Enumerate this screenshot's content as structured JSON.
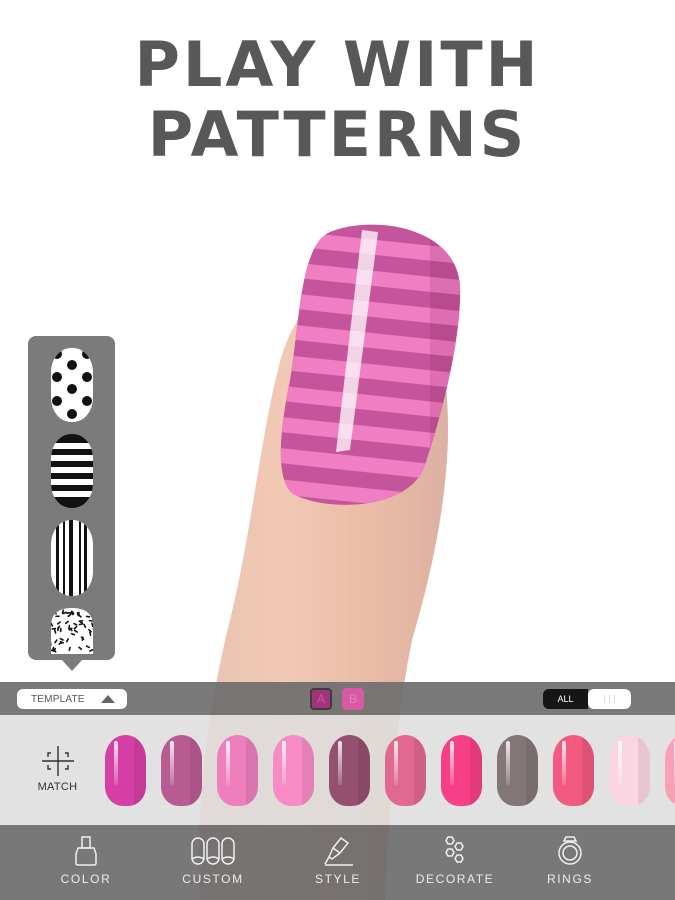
{
  "headline": {
    "line1": "PLAY WITH",
    "line2": "PATTERNS"
  },
  "preview": {
    "nail_pattern": "horizontal-stripes",
    "stripe_color_a": "#c4559c",
    "stripe_color_b": "#ef7ec2"
  },
  "pattern_picker": {
    "items": [
      {
        "name": "polka-dots",
        "icon": "polka-dot-nail-icon"
      },
      {
        "name": "horizontal-stripes",
        "icon": "horizontal-stripe-nail-icon"
      },
      {
        "name": "vertical-stripes",
        "icon": "vertical-stripe-nail-icon"
      },
      {
        "name": "sprinkles",
        "icon": "sprinkle-nail-icon"
      }
    ]
  },
  "toolbar": {
    "template_label": "TEMPLATE",
    "color_a_label": "A",
    "color_b_label": "B",
    "color_a": "#a1347a",
    "color_b": "#d85aa5",
    "toggle_all_label": "ALL",
    "toggle_single_icon": "three-bars-icon"
  },
  "color_strip": {
    "match_label": "MATCH",
    "swatches": [
      "#d63fa6",
      "#b85b92",
      "#ee7fbf",
      "#f78bc5",
      "#93506f",
      "#e06891",
      "#f63f86",
      "#837677",
      "#f25a82",
      "#fad6e2",
      "#f7a0b8"
    ]
  },
  "bottom_nav": {
    "items": [
      {
        "label": "COLOR",
        "icon": "nail-polish-bottle-icon"
      },
      {
        "label": "CUSTOM",
        "icon": "three-nails-icon"
      },
      {
        "label": "STYLE",
        "icon": "brush-pen-icon"
      },
      {
        "label": "DECORATE",
        "icon": "gems-icon"
      },
      {
        "label": "RINGS",
        "icon": "ring-icon"
      }
    ]
  }
}
